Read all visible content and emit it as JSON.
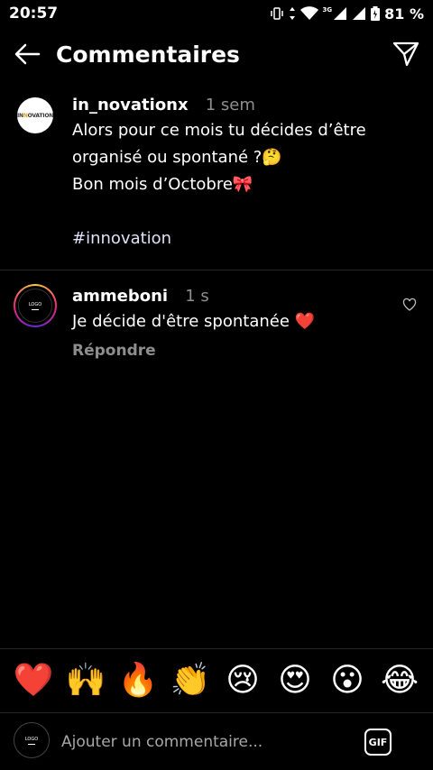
{
  "status_bar": {
    "time": "20:57",
    "battery": "81 %",
    "network": "3G"
  },
  "header": {
    "title": "Commentaires",
    "back_icon": "arrow-left-icon",
    "send_icon": "paper-plane-icon"
  },
  "post": {
    "username": "in_novationx",
    "time": "1 sem",
    "lines": [
      "Alors pour ce mois tu décides d’être",
      "organisé ou spontané ?🤔",
      "Bon mois d’Octobre🎀",
      "",
      "#innovation"
    ]
  },
  "comment": {
    "username": "ammeboni",
    "time": "1 s",
    "text": "Je décide d'être spontanée ❤️",
    "reply_label": "Répondre",
    "like_icon": "heart-outline-icon"
  },
  "emoji_bar": [
    "❤️",
    "🙌",
    "🔥",
    "👏",
    "😢",
    "😍",
    "😮",
    "😂"
  ],
  "composer": {
    "placeholder": "Ajouter un commentaire...",
    "gif_label": "GIF"
  },
  "colors": {
    "background": "#000000",
    "muted": "#8e8e8e",
    "divider": "#262626"
  }
}
